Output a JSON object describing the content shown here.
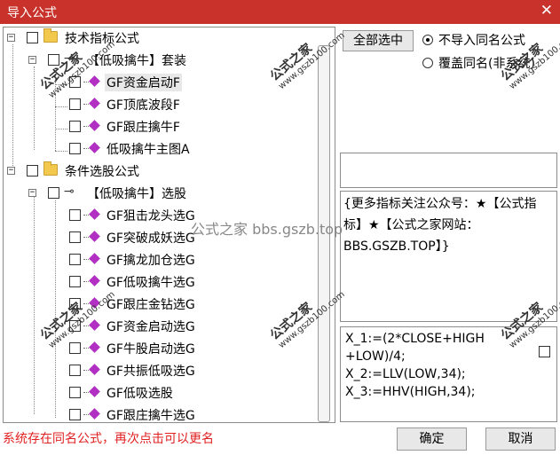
{
  "window": {
    "title": "导入公式",
    "close_glyph": "✕"
  },
  "tree": {
    "group1": {
      "label": "技术指标公式"
    },
    "sub1": {
      "label": "【低吸擒牛】套装"
    },
    "group1_items": [
      "GF资金启动F",
      "GF顶底波段F",
      "GF跟庄擒牛F",
      "低吸擒牛主图A"
    ],
    "group2": {
      "label": "条件选股公式"
    },
    "sub2": {
      "label": "【低吸擒牛】选股"
    },
    "group2_items": [
      "GF狙击龙头选G",
      "GF突破成妖选G",
      "GF擒龙加仓选G",
      "GF低吸擒牛选G",
      "GF跟庄金钻选G",
      "GF资金启动选G",
      "GF牛股启动选G",
      "GF共振低吸选G",
      "GF低吸选股",
      "GF跟庄擒牛选G"
    ]
  },
  "select_all_label": "全部选中",
  "options": {
    "no_import": "不导入同名公式",
    "overwrite": "覆盖同名(非系统)"
  },
  "description": "{更多指标关注公众号：★【公式指标】★【公式之家网站：BBS.GSZB.TOP】}",
  "formula_lines": [
    "X_1:=(2*CLOSE+HIGH",
    "+LOW)/4;",
    "X_2:=LLV(LOW,34);",
    "X_3:=HHV(HIGH,34);"
  ],
  "status_message": "系统存在同名公式，再次点击可以更名",
  "buttons": {
    "ok": "确定",
    "cancel": "取消"
  },
  "watermark": {
    "brand": "公式之家",
    "url": "www.gszb100.com",
    "center": "公式之家 bbs.gszb.top"
  }
}
